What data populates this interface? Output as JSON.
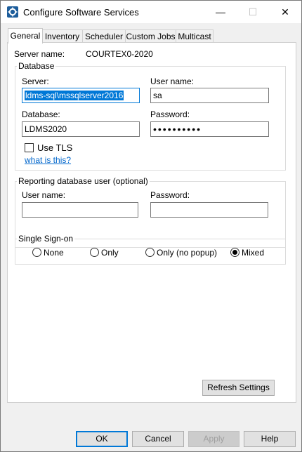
{
  "window": {
    "title": "Configure Software Services",
    "minimize": "—",
    "maximize": "☐",
    "close": "✕"
  },
  "tabs": [
    {
      "label": "General",
      "active": true
    },
    {
      "label": "Inventory"
    },
    {
      "label": "Scheduler"
    },
    {
      "label": "Custom Jobs"
    },
    {
      "label": "Multicast"
    }
  ],
  "general": {
    "server_name_label": "Server name:",
    "server_name_value": "COURTEX0-2020",
    "database_group": {
      "legend": "Database",
      "server_label": "Server:",
      "server_value": "ldms-sql\\mssqlserver2016",
      "user_label": "User name:",
      "user_value": "sa",
      "database_label": "Database:",
      "database_value": "LDMS2020",
      "password_label": "Password:",
      "password_value": "••••••••••",
      "use_tls_label": "Use TLS",
      "what_is_this": "what is this?"
    },
    "reporting_group": {
      "legend": "Reporting database user (optional)",
      "user_label": "User name:",
      "user_value": "",
      "password_label": "Password:",
      "password_value": ""
    },
    "sso_group": {
      "legend": "Single Sign-on",
      "options": [
        "None",
        "Only",
        "Only (no popup)",
        "Mixed"
      ],
      "selected": "Mixed"
    },
    "refresh_button": "Refresh Settings"
  },
  "footer": {
    "ok": "OK",
    "cancel": "Cancel",
    "apply": "Apply",
    "help": "Help"
  },
  "colors": {
    "accent": "#0078d7",
    "link": "#0066cc"
  }
}
